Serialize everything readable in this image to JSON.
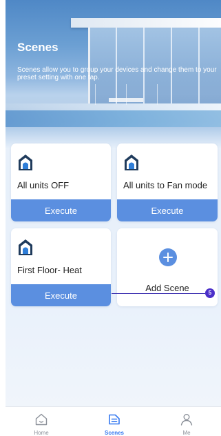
{
  "header": {
    "title": "Scenes",
    "description": "Scenes allow you to group your devices and change them to your preset setting with one tap."
  },
  "scenes": [
    {
      "name": "All units OFF",
      "action": "Execute",
      "icon": "home-icon"
    },
    {
      "name": "All units to Fan mode",
      "action": "Execute",
      "icon": "home-icon"
    },
    {
      "name": "First Floor- Heat",
      "action": "Execute",
      "icon": "home-icon"
    }
  ],
  "add_scene": {
    "label": "Add Scene",
    "icon": "plus-circle-icon"
  },
  "annotation": {
    "badge": "5"
  },
  "tabbar": {
    "items": [
      {
        "label": "Home",
        "icon": "home-outline-icon",
        "active": false
      },
      {
        "label": "Scenes",
        "icon": "scenes-icon",
        "active": true
      },
      {
        "label": "Me",
        "icon": "user-icon",
        "active": false
      }
    ]
  },
  "colors": {
    "accent": "#5b8fe0",
    "active_tab": "#3478f0",
    "inactive_tab": "#8a8f98",
    "annotation": "#4b2fc9"
  }
}
